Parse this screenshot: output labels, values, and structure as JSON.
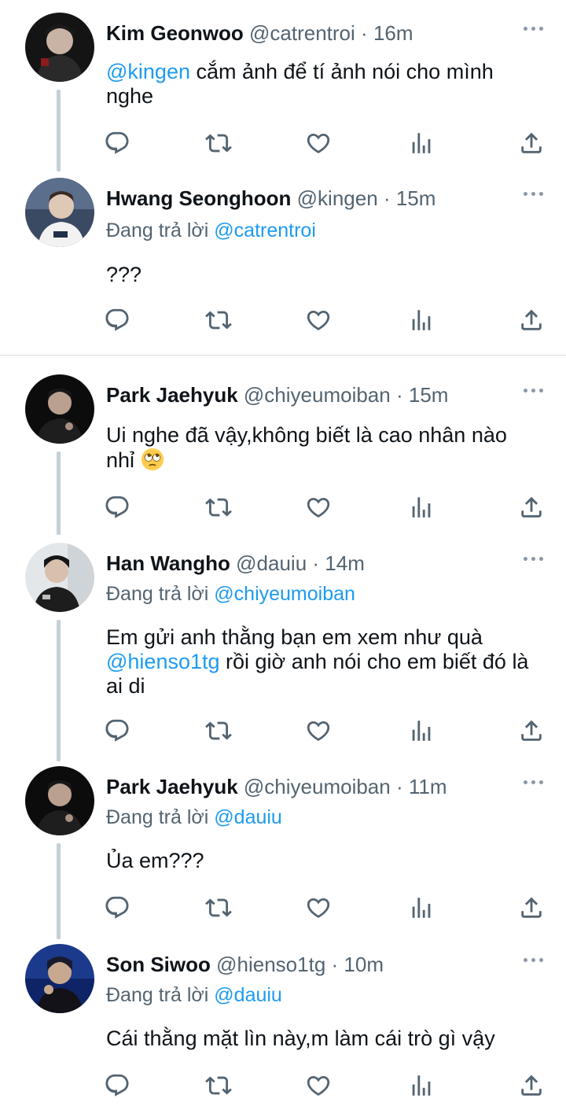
{
  "tweets": [
    {
      "name": "Kim Geonwoo",
      "handle": "@catrentroi",
      "dot": "·",
      "time": "16m",
      "replying_prefix": "",
      "replying_to": "",
      "mention": "@kingen",
      "text": " cắm ảnh để tí ảnh nói cho mình nghe"
    },
    {
      "name": "Hwang Seonghoon",
      "handle": "@kingen",
      "dot": "·",
      "time": "15m",
      "replying_prefix": "Đang trả lời ",
      "replying_to": "@catrentroi",
      "text": "???"
    },
    {
      "name": "Park Jaehyuk",
      "handle": "@chiyeumoiban",
      "dot": "·",
      "time": "15m",
      "text": "Ui nghe đã vậy,không biết là cao nhân nào nhỉ"
    },
    {
      "name": "Han Wangho",
      "handle": "@dauiu",
      "dot": "·",
      "time": "14m",
      "replying_prefix": "Đang trả lời ",
      "replying_to": "@chiyeumoiban",
      "text_before": "Em gửi anh thằng bạn em xem như quà ",
      "mention": "@hienso1tg",
      "text_after": " rồi giờ anh nói cho em biết đó là ai di"
    },
    {
      "name": "Park Jaehyuk",
      "handle": "@chiyeumoiban",
      "dot": "·",
      "time": "11m",
      "replying_prefix": "Đang trả lời ",
      "replying_to": "@dauiu",
      "text": "Ủa em???"
    },
    {
      "name": "Son Siwoo",
      "handle": "@hienso1tg",
      "dot": "·",
      "time": "10m",
      "replying_prefix": "Đang trả lời ",
      "replying_to": "@dauiu",
      "text": "Cái thằng mặt lìn này,m làm cái trò gì vậy"
    }
  ],
  "icons": {
    "reply": "reply-icon",
    "retweet": "retweet-icon",
    "like": "like-icon",
    "views": "views-icon",
    "share": "share-icon",
    "more": "more-icon"
  },
  "colors": {
    "mention": "#1d9bf0",
    "secondary_text": "#536471",
    "thread_line": "#c4cfd6"
  }
}
